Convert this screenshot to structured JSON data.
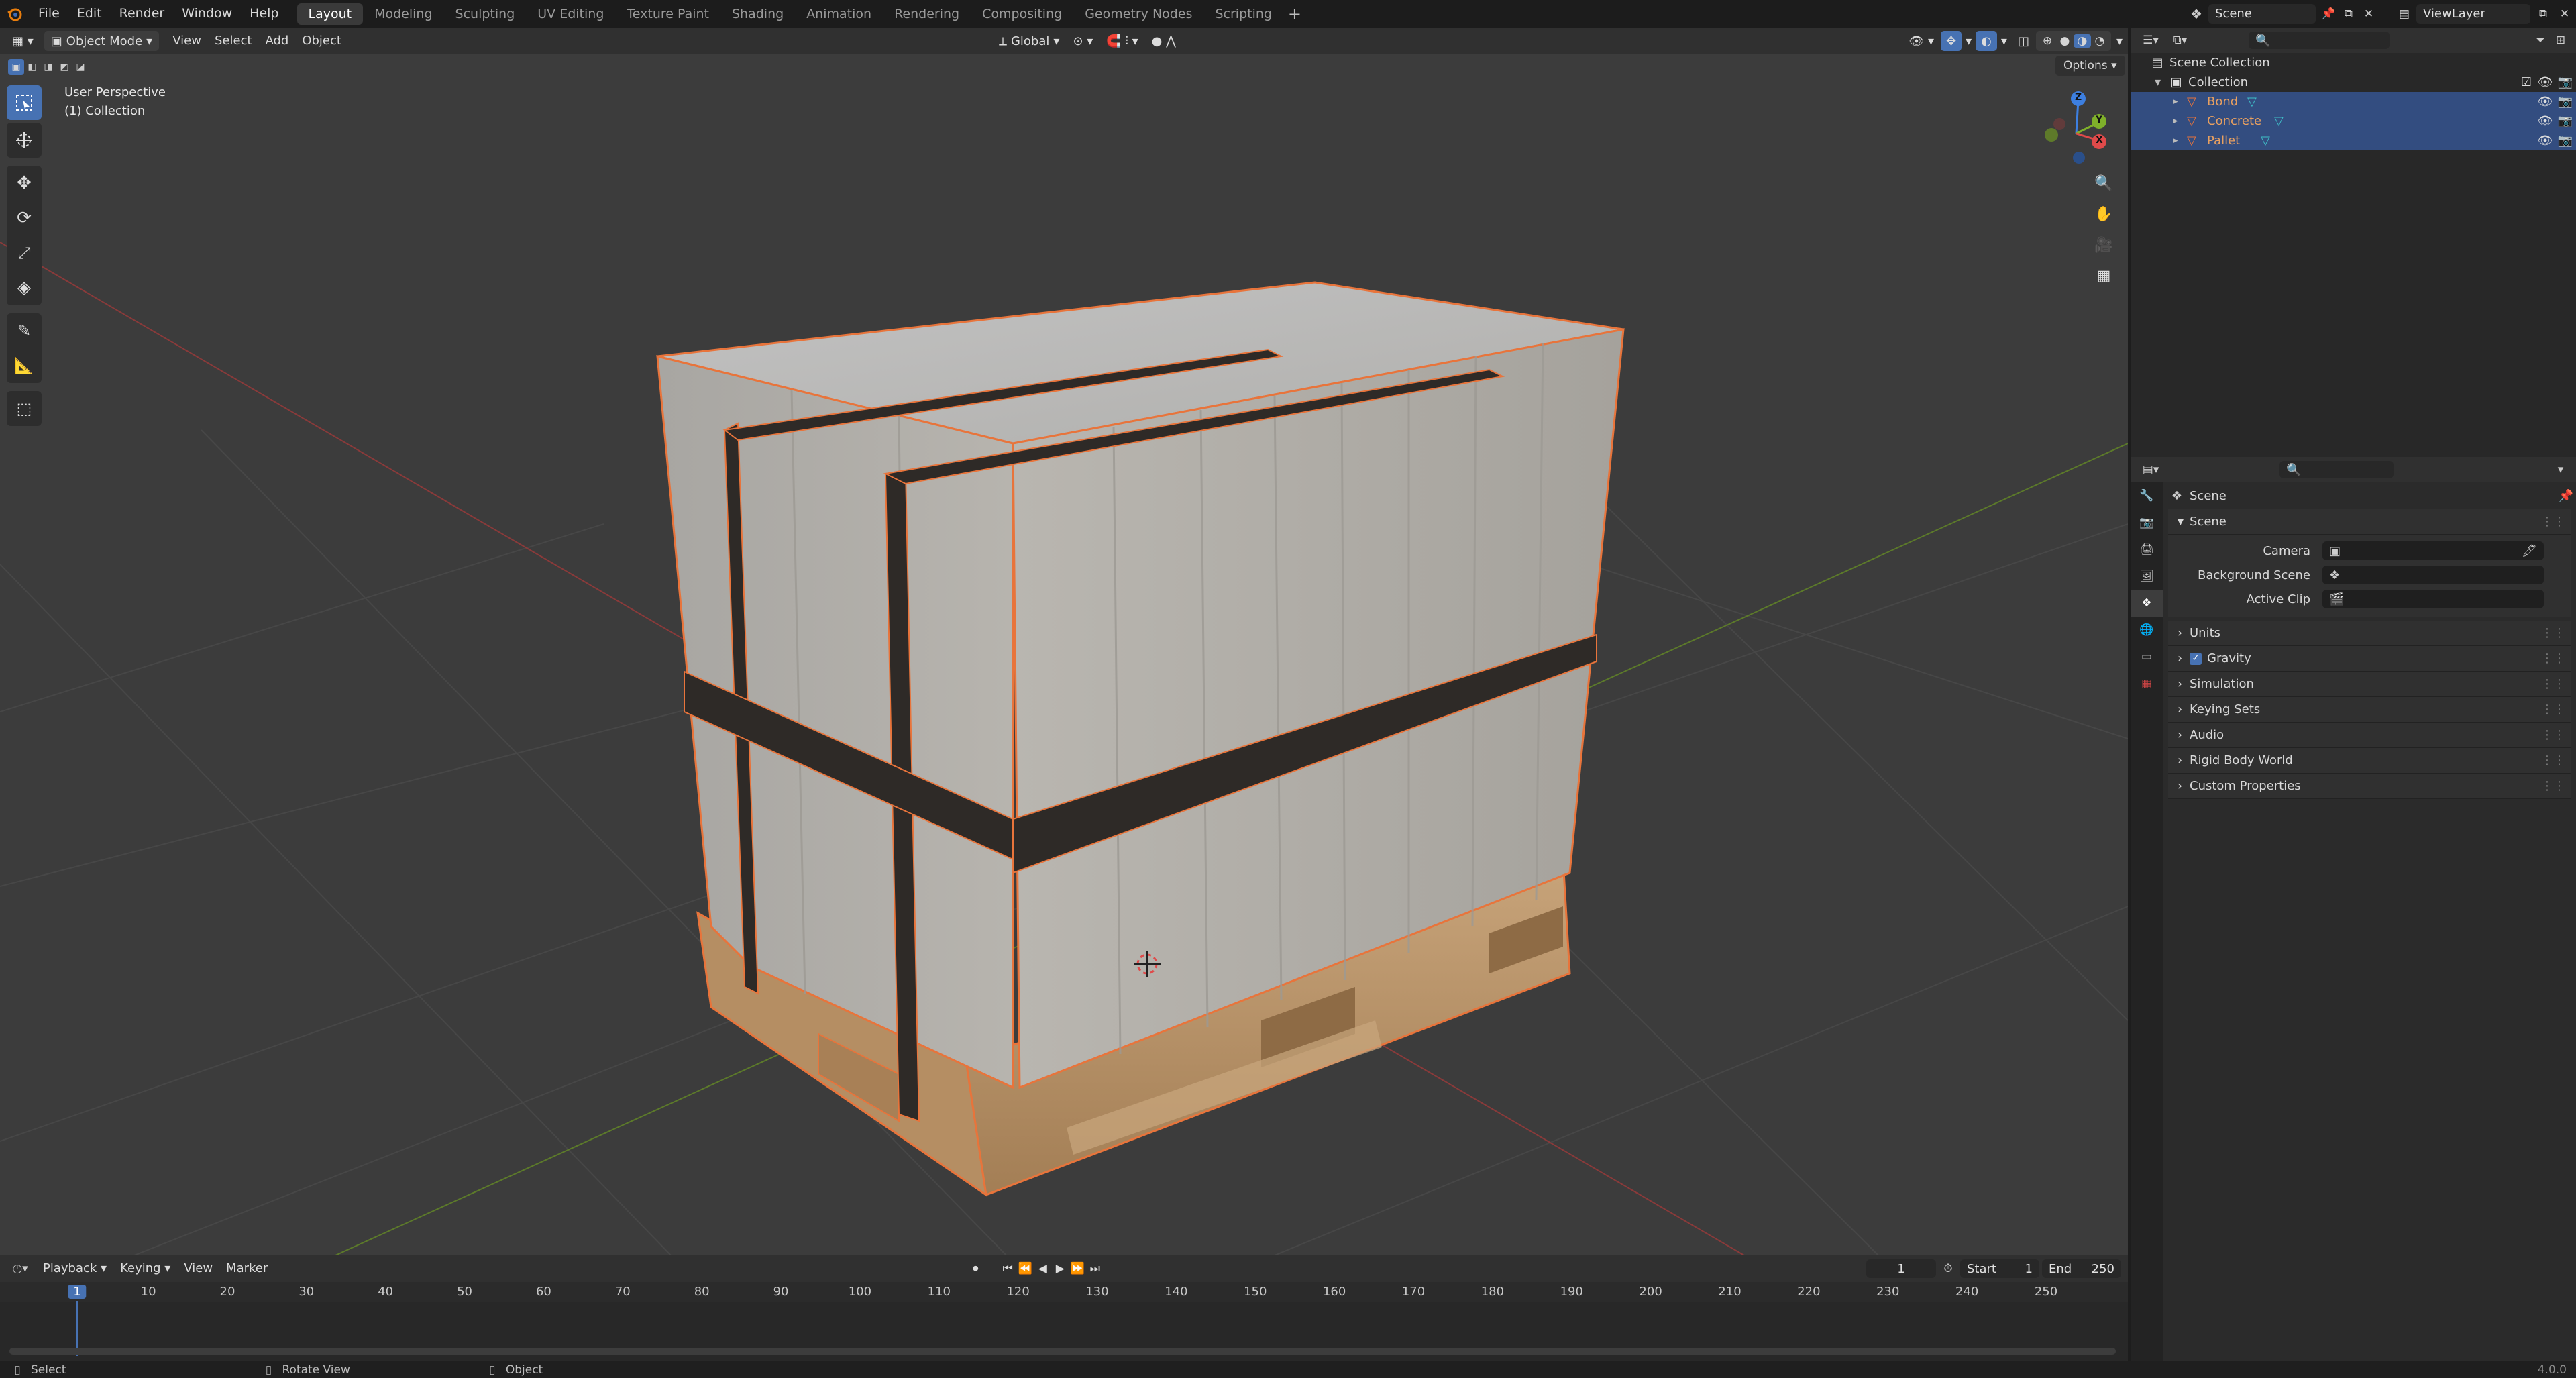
{
  "menu": {
    "file": "File",
    "edit": "Edit",
    "render": "Render",
    "window": "Window",
    "help": "Help"
  },
  "workspaces": [
    "Layout",
    "Modeling",
    "Sculpting",
    "UV Editing",
    "Texture Paint",
    "Shading",
    "Animation",
    "Rendering",
    "Compositing",
    "Geometry Nodes",
    "Scripting"
  ],
  "active_workspace": "Layout",
  "scene_name": "Scene",
  "view_layer": "ViewLayer",
  "viewport_header": {
    "mode": "Object Mode",
    "view": "View",
    "select": "Select",
    "add": "Add",
    "object": "Object",
    "orientation": "Global",
    "options": "Options"
  },
  "viewport_overlay": {
    "perspective": "User Perspective",
    "collection": "(1) Collection"
  },
  "gizmo": {
    "z": "Z",
    "y": "Y",
    "x": "X"
  },
  "outliner": {
    "root": "Scene Collection",
    "collection": "Collection",
    "objects": [
      "Bond",
      "Concrete",
      "Pallet"
    ]
  },
  "properties": {
    "breadcrumb": "Scene",
    "section": "Scene",
    "camera_label": "Camera",
    "background_scene_label": "Background Scene",
    "active_clip_label": "Active Clip",
    "subpanels": [
      "Units",
      "Gravity",
      "Simulation",
      "Keying Sets",
      "Audio",
      "Rigid Body World",
      "Custom Properties"
    ],
    "gravity_checked": true
  },
  "timeline": {
    "playback": "Playback",
    "keying": "Keying",
    "view": "View",
    "marker": "Marker",
    "current_frame": "1",
    "start_label": "Start",
    "start": "1",
    "end_label": "End",
    "end": "250",
    "ticks": [
      "1",
      "10",
      "20",
      "30",
      "40",
      "50",
      "60",
      "70",
      "80",
      "90",
      "100",
      "110",
      "120",
      "130",
      "140",
      "150",
      "160",
      "170",
      "180",
      "190",
      "200",
      "210",
      "220",
      "230",
      "240",
      "250"
    ]
  },
  "status": {
    "select": "Select",
    "rotate_view": "Rotate View",
    "object": "Object",
    "version": "4.0.0"
  },
  "colors": {
    "accent": "#4772b3",
    "selection_outline": "#e8743b",
    "outliner_selected_bg": "#334d80",
    "axis_x": "#e04a4a",
    "axis_y": "#7fb02a",
    "axis_z": "#3d7fe0"
  }
}
